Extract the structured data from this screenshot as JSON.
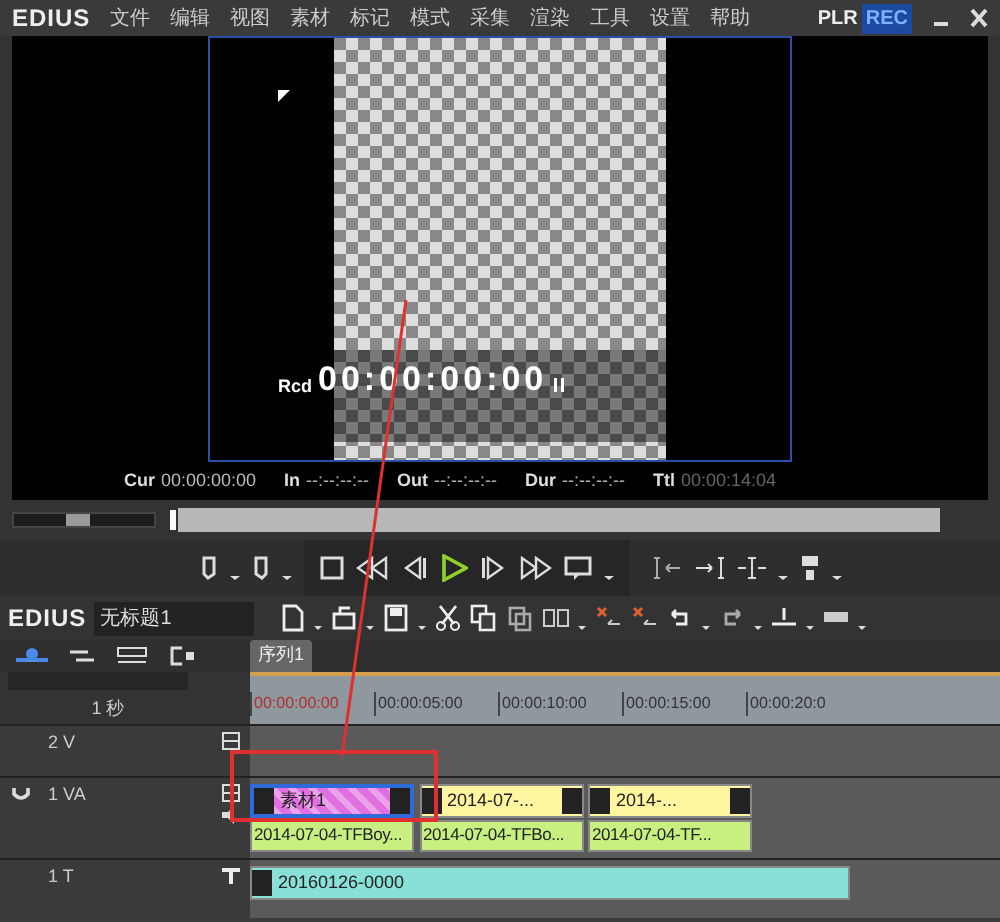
{
  "menu": {
    "logo": "EDIUS",
    "items": [
      "文件",
      "编辑",
      "视图",
      "素材",
      "标记",
      "模式",
      "采集",
      "渲染",
      "工具",
      "设置",
      "帮助"
    ]
  },
  "modes": [
    {
      "label": "PLR",
      "selected": false
    },
    {
      "label": "REC",
      "selected": true
    }
  ],
  "preview": {
    "rcd_label": "Rcd",
    "timecode": "00:00:00:00"
  },
  "timecodes": [
    {
      "label": "Cur",
      "value": "00:00:00:00",
      "disabled": false
    },
    {
      "label": "In",
      "value": "--:--:--:--",
      "disabled": false
    },
    {
      "label": "Out",
      "value": "--:--:--:--",
      "disabled": false
    },
    {
      "label": "Dur",
      "value": "--:--:--:--",
      "disabled": false
    },
    {
      "label": "Ttl",
      "value": "00:00:14:04",
      "disabled": true
    }
  ],
  "shuttle": {
    "level": 0.45
  },
  "position": {
    "level": 0
  },
  "timeline": {
    "logo": "EDIUS",
    "project": "无标题1",
    "sequence_tab": "序列1",
    "zoom": "1 秒",
    "ruler": [
      "00:00:00:00",
      "00:00:05:00",
      "00:00:10:00",
      "00:00:15:00",
      "00:00:20:0"
    ],
    "tracks": [
      {
        "name": "2 V",
        "kind": "video"
      },
      {
        "name": "1 VA",
        "kind": "va",
        "clips": [
          {
            "label": "素材1",
            "color": "#e070e0",
            "selected": true
          },
          {
            "label": "2014-07-...",
            "color": "#fff4a0",
            "selected": false
          },
          {
            "label": "2014-...",
            "color": "#fff4a0",
            "selected": false
          }
        ],
        "audio_clips": [
          "2014-07-04-TFBoy...",
          "2014-07-04-TFBo...",
          "2014-07-04-TF..."
        ]
      },
      {
        "name": "1 T",
        "kind": "title",
        "clips": [
          {
            "label": "20160126-0000",
            "color": "#88e0d8",
            "selected": false
          }
        ]
      }
    ]
  }
}
